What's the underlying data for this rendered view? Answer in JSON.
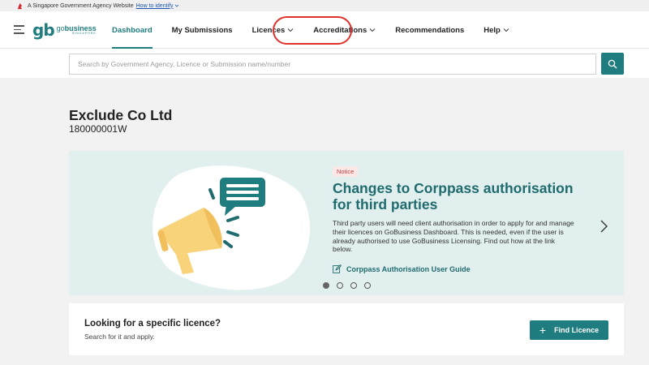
{
  "masthead": {
    "text": "A Singapore Government Agency Website",
    "link": "How to identify"
  },
  "logo": {
    "mark": "gb",
    "go": "go",
    "business": "business",
    "country": "SINGAPORE"
  },
  "nav": {
    "items": [
      {
        "label": "Dashboard",
        "active": true
      },
      {
        "label": "My Submissions"
      },
      {
        "label": "Licences",
        "dropdown": true
      },
      {
        "label": "Accreditations",
        "dropdown": true,
        "highlighted": true
      },
      {
        "label": "Recommendations"
      },
      {
        "label": "Help",
        "dropdown": true
      }
    ]
  },
  "search": {
    "placeholder": "Search by Government Agency, Licence or Submission name/number"
  },
  "company": {
    "name": "Exclude Co Ltd",
    "uen": "180000001W"
  },
  "carousel": {
    "badge": "Notice",
    "title": "Changes to Corppass authorisation for third parties",
    "body": "Third party users will need client authorisation in order to apply for and manage their licences on GoBusiness Dashboard. This is needed, even if the user is already authorised to use GoBusiness Licensing. Find out how at the link below.",
    "link_label": "Corppass Authorisation User Guide",
    "active_slide": 1,
    "slide_count": 4
  },
  "licence_card": {
    "title": "Looking for a specific licence?",
    "subtitle": "Search for it and apply.",
    "button_label": "Find Licence"
  },
  "colors": {
    "brand": "#1f7d80",
    "highlight": "#e0312a",
    "banner_bg": "#e1efee"
  }
}
